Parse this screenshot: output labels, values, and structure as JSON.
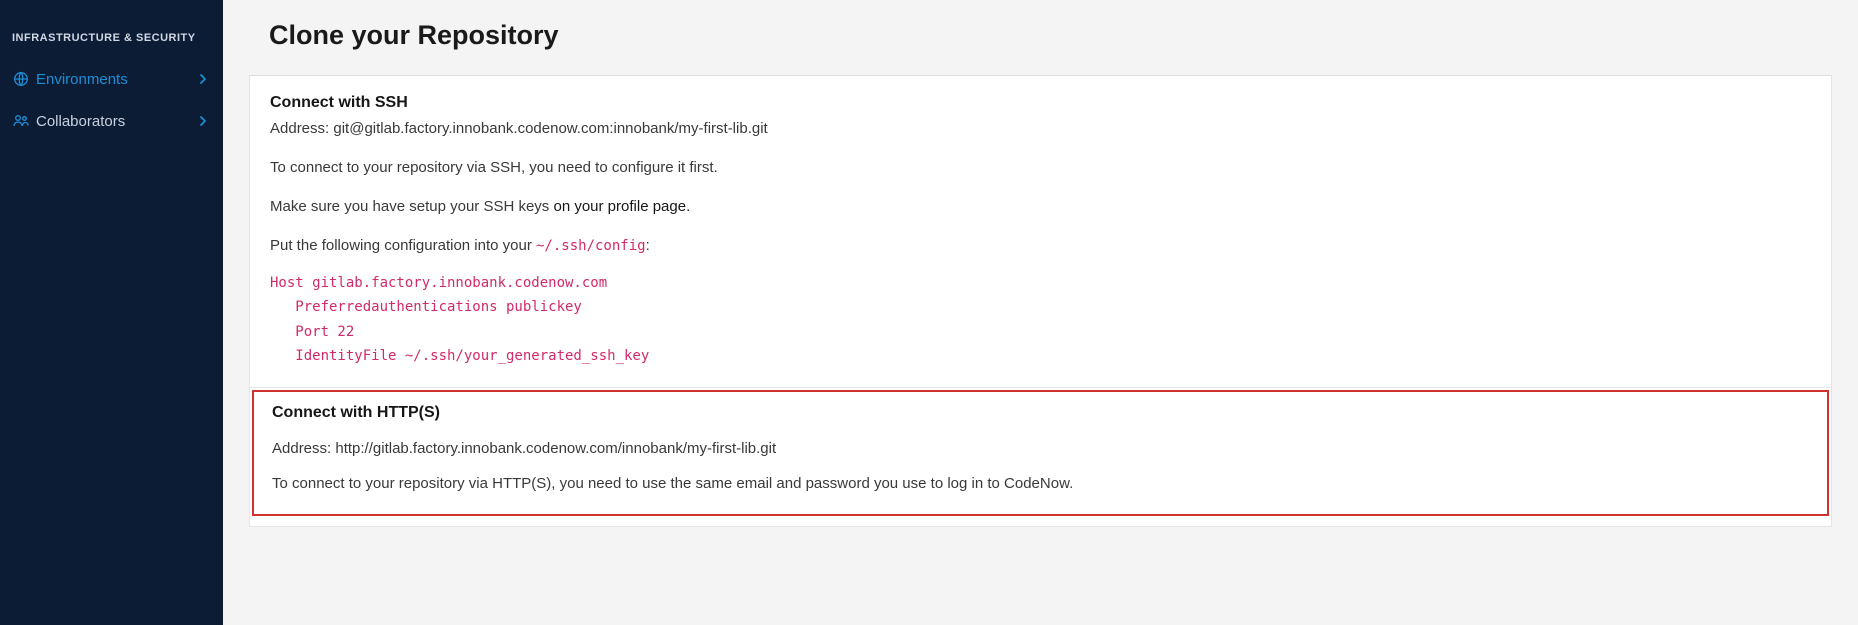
{
  "sidebar": {
    "section_title": "INFRASTRUCTURE & SECURITY",
    "items": [
      {
        "label": "Environments"
      },
      {
        "label": "Collaborators"
      }
    ]
  },
  "page": {
    "title": "Clone your Repository"
  },
  "ssh": {
    "heading": "Connect with SSH",
    "address_label": "Address: ",
    "address": "git@gitlab.factory.innobank.codenow.com:innobank/my-first-lib.git",
    "connect_text": "To connect to your repository via SSH, you need to configure it first.",
    "keys_text_pre": "Make sure you have setup your SSH keys ",
    "keys_link": "on your profile page.",
    "config_text_pre": "Put the following configuration into your ",
    "config_path": "~/.ssh/config",
    "config_text_post": ":",
    "config_block": "Host gitlab.factory.innobank.codenow.com\n   Preferredauthentications publickey\n   Port 22\n   IdentityFile ~/.ssh/your_generated_ssh_key"
  },
  "http": {
    "heading": "Connect with HTTP(S)",
    "address_label": "Address: ",
    "address": "http://gitlab.factory.innobank.codenow.com/innobank/my-first-lib.git",
    "connect_text": "To connect to your repository via HTTP(S), you need to use the same email and password you use to log in to CodeNow."
  }
}
